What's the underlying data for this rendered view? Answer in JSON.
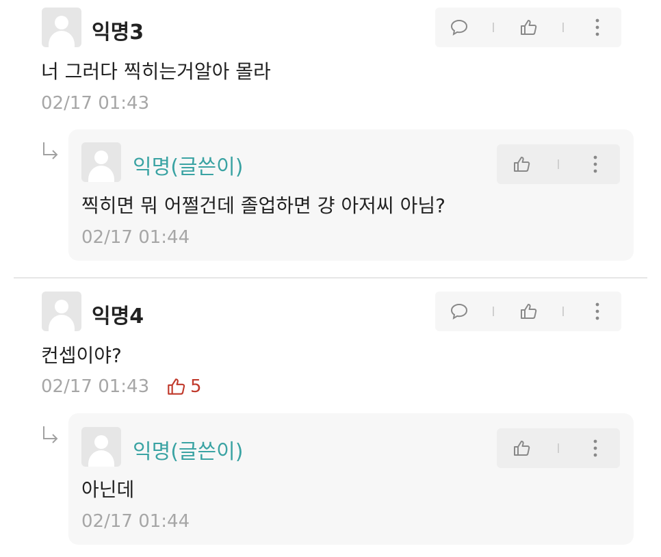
{
  "comments": [
    {
      "author": "익명3",
      "text": "너 그러다 찍히는거알아 몰라",
      "date": "02/17 01:43",
      "reply": {
        "author": "익명(글쓴이)",
        "text": "찍히면 뭐 어쩔건데 졸업하면 걍 아저씨 아님?",
        "date": "02/17 01:44"
      }
    },
    {
      "author": "익명4",
      "text": "컨셉이야?",
      "date": "02/17 01:43",
      "likes": "5",
      "reply": {
        "author": "익명(글쓴이)",
        "text": "아닌데",
        "date": "02/17 01:44"
      }
    }
  ],
  "icons": {
    "comment": "speech-bubble-icon",
    "like": "thumbs-up-icon",
    "more": "vertical-ellipsis-icon",
    "reply": "reply-arrow-icon"
  },
  "colors": {
    "op_author": "#3aa3a3",
    "like_count": "#c0392b",
    "date": "#a6a6a6"
  }
}
